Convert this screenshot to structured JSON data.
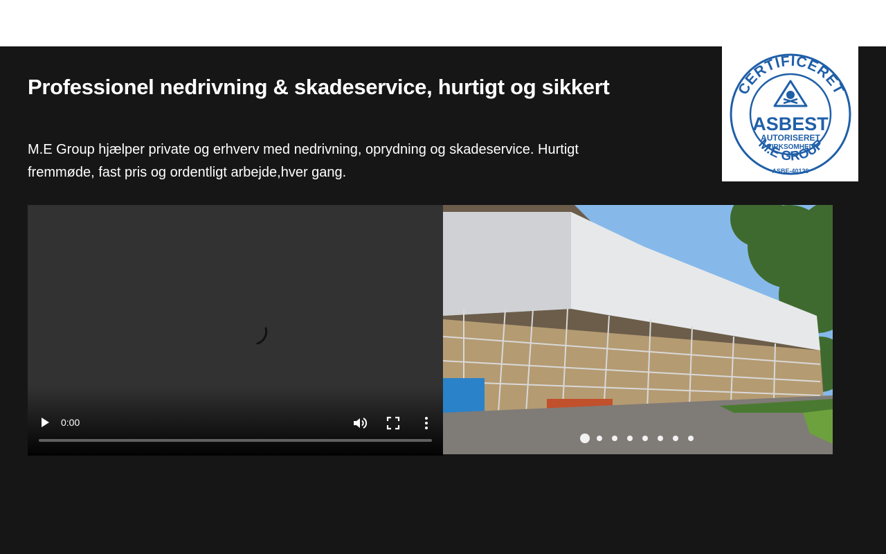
{
  "hero": {
    "headline": "Professionel nedrivning & skadeservice,  hurtigt og sikkert",
    "intro": "M.E Group hjælper private og erhverv med nedrivning, oprydning og skadeservice. Hurtigt fremmøde, fast pris og ordentligt arbejde,hver gang."
  },
  "badge": {
    "ring_text": "CERTIFICERET",
    "main": "ASBEST",
    "line1": "AUTORISERET",
    "line2": "VIRKSOMHED",
    "company": "M.E GROUP",
    "code": "ASBE-40129",
    "color": "#1f5fa8"
  },
  "video": {
    "time": "0:00",
    "progress": 0
  },
  "slider": {
    "slide_count": 8,
    "active_index": 0
  },
  "colors": {
    "hero_bg": "#161616",
    "video_bg": "#323232"
  }
}
